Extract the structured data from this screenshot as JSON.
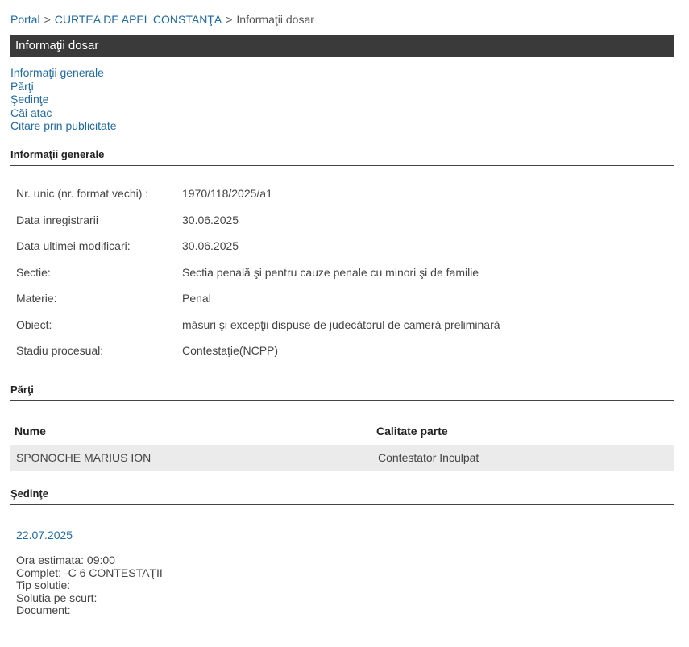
{
  "breadcrumb": {
    "portal": "Portal",
    "court": "CURTEA DE APEL CONSTANŢA",
    "current": "Informaţii dosar",
    "separator": ">"
  },
  "title_bar": {
    "title": "Informaţii dosar"
  },
  "nav_links": [
    "Informaţii generale",
    "Părţi",
    "Şedinţe",
    "Căi atac",
    "Citare prin publicitate"
  ],
  "general_info": {
    "heading": "Informaţii generale",
    "rows": [
      {
        "label": "Nr. unic (nr. format vechi) :",
        "value": "1970/118/2025/a1"
      },
      {
        "label": "Data inregistrarii",
        "value": "30.06.2025"
      },
      {
        "label": "Data ultimei modificari:",
        "value": "30.06.2025"
      },
      {
        "label": "Sectie:",
        "value": "Sectia penală şi pentru cauze penale cu minori şi de familie"
      },
      {
        "label": "Materie:",
        "value": "Penal"
      },
      {
        "label": "Obiect:",
        "value": "măsuri şi excepţii dispuse de judecătorul de cameră preliminară"
      },
      {
        "label": "Stadiu procesual:",
        "value": "Contestaţie(NCPP)"
      }
    ]
  },
  "parties": {
    "heading": "Părţi",
    "columns": [
      "Nume",
      "Calitate parte"
    ],
    "rows": [
      {
        "name": "SPONOCHE MARIUS ION",
        "role": "Contestator Inculpat"
      }
    ]
  },
  "hearings": {
    "heading": "Şedinţe",
    "date": "22.07.2025",
    "details": [
      "Ora estimata: 09:00",
      "Complet: -C 6 CONTESTAŢII",
      "Tip solutie:",
      "Solutia pe scurt:",
      "Document:"
    ]
  },
  "colors": {
    "link": "#1e6aa5",
    "title_bar_bg": "#3a3a3a",
    "row_highlight": "#ebebeb"
  }
}
